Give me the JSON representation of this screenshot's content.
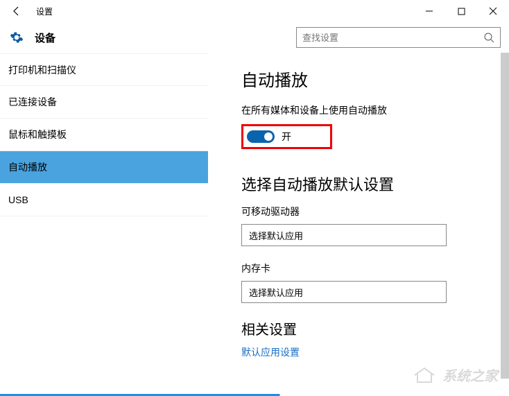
{
  "window": {
    "title": "设置"
  },
  "header": {
    "device_label": "设备"
  },
  "search": {
    "placeholder": "查找设置"
  },
  "sidebar": {
    "items": [
      {
        "label": "打印机和扫描仪",
        "selected": false
      },
      {
        "label": "已连接设备",
        "selected": false
      },
      {
        "label": "鼠标和触摸板",
        "selected": false
      },
      {
        "label": "自动播放",
        "selected": true
      },
      {
        "label": "USB",
        "selected": false
      }
    ]
  },
  "main": {
    "heading": "自动播放",
    "toggle_desc": "在所有媒体和设备上使用自动播放",
    "toggle_state": "开",
    "defaults_heading": "选择自动播放默认设置",
    "removable_label": "可移动驱动器",
    "removable_value": "选择默认应用",
    "memorycard_label": "内存卡",
    "memorycard_value": "选择默认应用",
    "related_heading": "相关设置",
    "related_link": "默认应用设置"
  },
  "watermark": {
    "text": "系统之家"
  }
}
